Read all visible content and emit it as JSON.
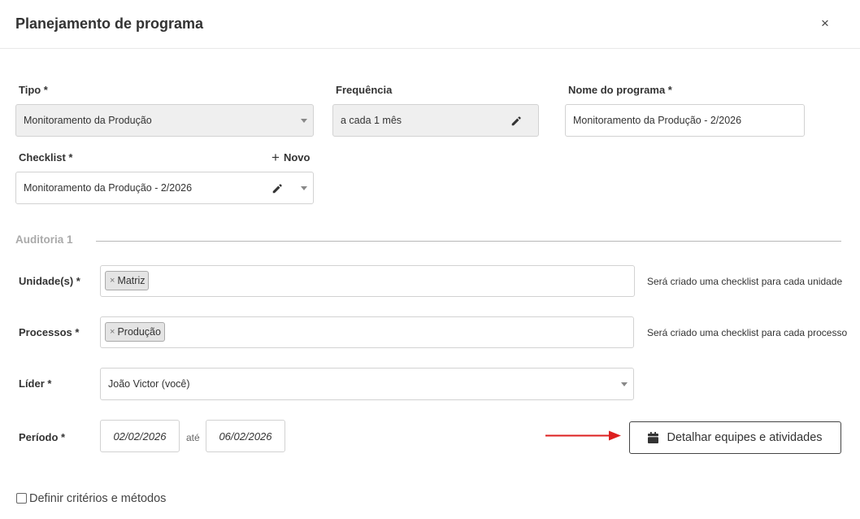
{
  "modal": {
    "title": "Planejamento de programa",
    "close_label": "×"
  },
  "form": {
    "tipo": {
      "label": "Tipo *",
      "value": "Monitoramento da Produção"
    },
    "frequencia": {
      "label": "Frequência",
      "value": "a cada 1 mês"
    },
    "nome_programa": {
      "label": "Nome do programa *",
      "value": "Monitoramento da Produção - 2/2026"
    },
    "checklist": {
      "label": "Checklist *",
      "value": "Monitoramento da Produção - 2/2026",
      "novo_label": "Novo",
      "novo_icon": "+"
    }
  },
  "auditoria": {
    "title": "Auditoria 1",
    "unidades": {
      "label": "Unidade(s) *",
      "tags": [
        "Matriz"
      ],
      "hint": "Será criado uma checklist para cada unidade"
    },
    "processos": {
      "label": "Processos *",
      "tags": [
        "Produção"
      ],
      "hint": "Será criado uma checklist para cada processo"
    },
    "lider": {
      "label": "Líder *",
      "value": "João Victor (você)"
    },
    "periodo": {
      "label": "Período *",
      "start": "02/02/2026",
      "sep": "até",
      "end": "06/02/2026"
    },
    "detail_button": {
      "label": "Detalhar equipes e atividades",
      "icon": "calendar-icon"
    }
  },
  "options": {
    "criterios_label": "Definir critérios e métodos",
    "criterios_checked": false
  },
  "colors": {
    "annotation_arrow": "#dd1f1f",
    "disabled_field_bg": "#efefef",
    "section_title": "#aaaaaa"
  },
  "tag_remove_glyph": "×"
}
